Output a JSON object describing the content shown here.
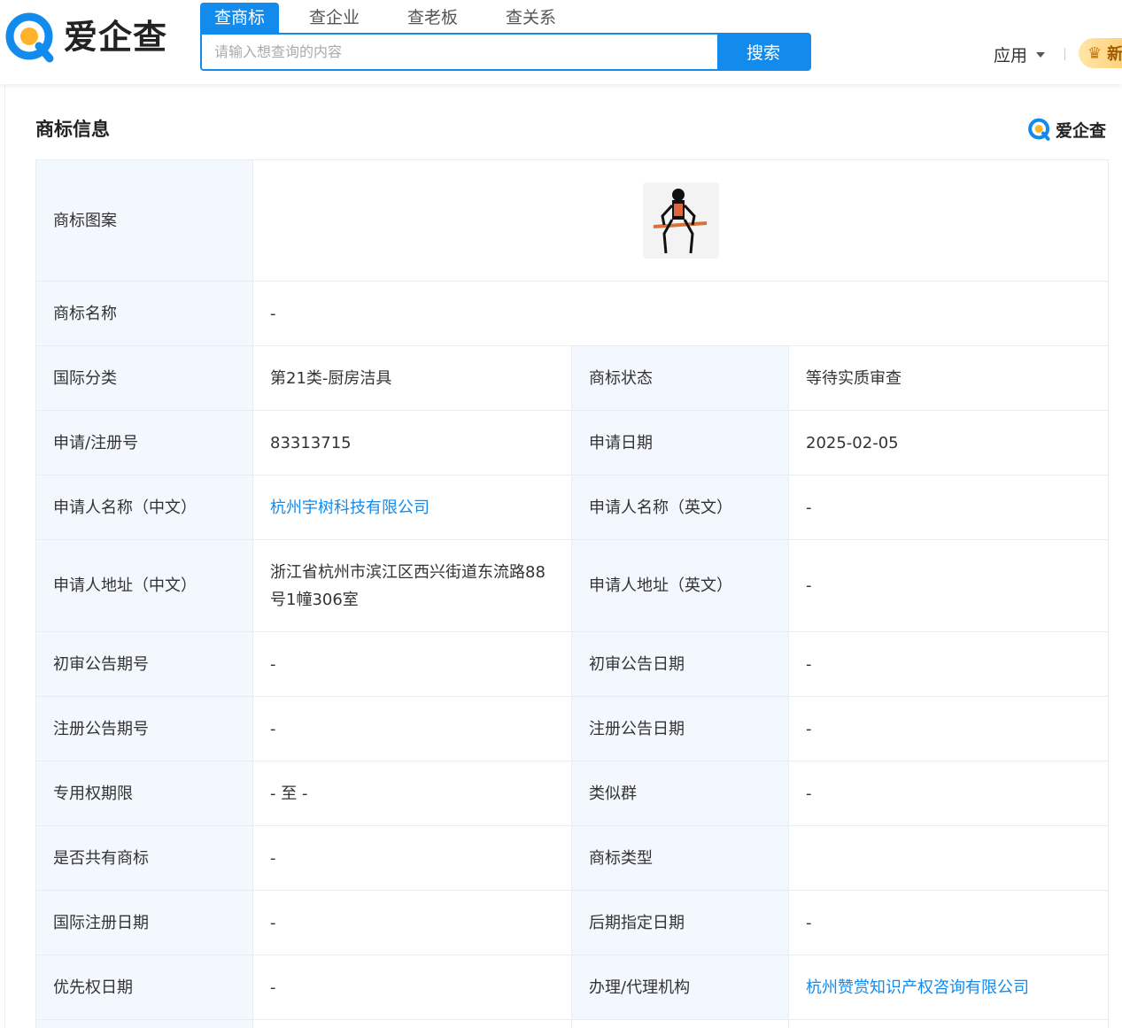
{
  "header": {
    "logo_text": "爱企查",
    "tabs": [
      "查商标",
      "查企业",
      "查老板",
      "查关系"
    ],
    "search_placeholder": "请输入想查询的内容",
    "search_button": "搜索",
    "app_menu": "应用",
    "vip_label": "新"
  },
  "section": {
    "title": "商标信息",
    "brand_label": "爱企查"
  },
  "rows": {
    "r0": {
      "label": "商标图案"
    },
    "r1": {
      "label": "商标名称",
      "value": "-"
    },
    "r2": {
      "label1": "国际分类",
      "value1": "第21类-厨房洁具",
      "label2": "商标状态",
      "value2": "等待实质审查"
    },
    "r3": {
      "label1": "申请/注册号",
      "value1": "83313715",
      "label2": "申请日期",
      "value2": "2025-02-05"
    },
    "r4": {
      "label1": "申请人名称（中文）",
      "value1": "杭州宇树科技有限公司",
      "label2": "申请人名称（英文）",
      "value2": "-"
    },
    "r5": {
      "label1": "申请人地址（中文）",
      "value1": "浙江省杭州市滨江区西兴街道东流路88号1幢306室",
      "label2": "申请人地址（英文）",
      "value2": "-"
    },
    "r6": {
      "label1": "初审公告期号",
      "value1": "-",
      "label2": "初审公告日期",
      "value2": "-"
    },
    "r7": {
      "label1": "注册公告期号",
      "value1": "-",
      "label2": "注册公告日期",
      "value2": "-"
    },
    "r8": {
      "label1": "专用权期限",
      "value1": "- 至 -",
      "label2": "类似群",
      "value2": "-"
    },
    "r9": {
      "label1": "是否共有商标",
      "value1": "-",
      "label2": "商标类型",
      "value2": ""
    },
    "r10": {
      "label1": "国际注册日期",
      "value1": "-",
      "label2": "后期指定日期",
      "value2": "-"
    },
    "r11": {
      "label1": "优先权日期",
      "value1": "-",
      "label2": "办理/代理机构",
      "value2": "杭州赞赏知识产权咨询有限公司"
    }
  },
  "colors": {
    "accent": "#128bed",
    "label_bg": "#f2f8fe",
    "border": "#e6edf5"
  },
  "icons": [
    "aiqicha-logo-icon",
    "caret-down-icon",
    "crown-icon",
    "trademark-image"
  ]
}
